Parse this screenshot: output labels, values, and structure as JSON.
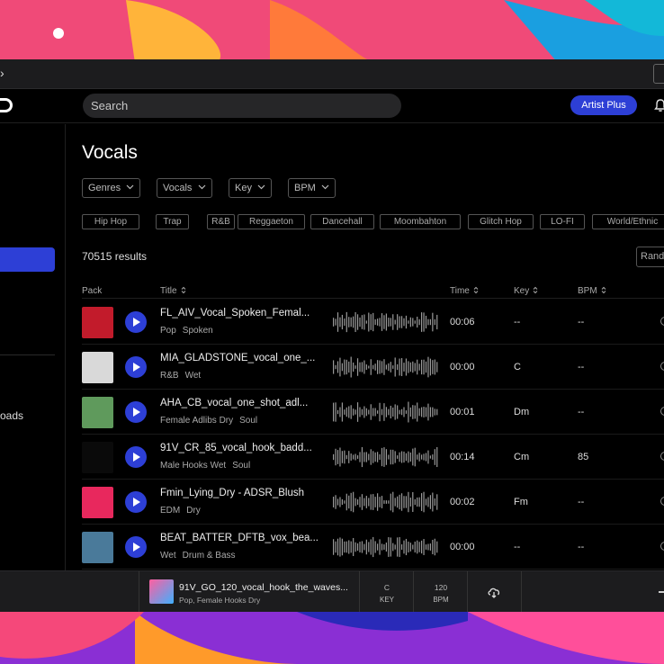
{
  "app": {
    "search_placeholder": "Search",
    "artist_button": "Artist Plus"
  },
  "sidebar": {
    "partial_label": "oads"
  },
  "page": {
    "title": "Vocals",
    "filters": [
      "Genres",
      "Vocals",
      "Key",
      "BPM"
    ],
    "tags": [
      "Hip Hop",
      "Trap",
      "R&B",
      "Reggaeton",
      "Dancehall",
      "Moombahton",
      "Glitch Hop",
      "LO-FI",
      "World/Ethnic"
    ],
    "results": "70515 results",
    "random_label": "Rand",
    "columns": {
      "pack": "Pack",
      "title": "Title",
      "time": "Time",
      "key": "Key",
      "bpm": "BPM"
    }
  },
  "rows": [
    {
      "title": "FL_AIV_Vocal_Spoken_Femal...",
      "tags": [
        "Pop",
        "Spoken"
      ],
      "time": "00:06",
      "key": "--",
      "bpm": "--",
      "cover": "#c21b2b"
    },
    {
      "title": "MIA_GLADSTONE_vocal_one_...",
      "tags": [
        "R&B",
        "Wet"
      ],
      "time": "00:00",
      "key": "C",
      "bpm": "--",
      "cover": "#d9d9d9"
    },
    {
      "title": "AHA_CB_vocal_one_shot_adl...",
      "tags": [
        "Female Adlibs Dry",
        "Soul"
      ],
      "time": "00:01",
      "key": "Dm",
      "bpm": "--",
      "cover": "#5f9a5c"
    },
    {
      "title": "91V_CR_85_vocal_hook_badd...",
      "tags": [
        "Male Hooks Wet",
        "Soul"
      ],
      "time": "00:14",
      "key": "Cm",
      "bpm": "85",
      "cover": "#0a0a0a"
    },
    {
      "title": "Fmin_Lying_Dry - ADSR_Blush",
      "tags": [
        "EDM",
        "Dry"
      ],
      "time": "00:02",
      "key": "Fm",
      "bpm": "--",
      "cover": "#e8285d"
    },
    {
      "title": "BEAT_BATTER_DFTB_vox_bea...",
      "tags": [
        "Wet",
        "Drum & Bass"
      ],
      "time": "00:00",
      "key": "--",
      "bpm": "--",
      "cover": "#4a7a9a"
    }
  ],
  "player": {
    "title": "91V_GO_120_vocal_hook_the_waves...",
    "subtitle": "Pop, Female Hooks Dry",
    "key_value": "C",
    "key_label": "KEY",
    "bpm_value": "120",
    "bpm_label": "BPM"
  },
  "colors": {
    "accent": "#2d3fd6",
    "background": "#000000"
  }
}
